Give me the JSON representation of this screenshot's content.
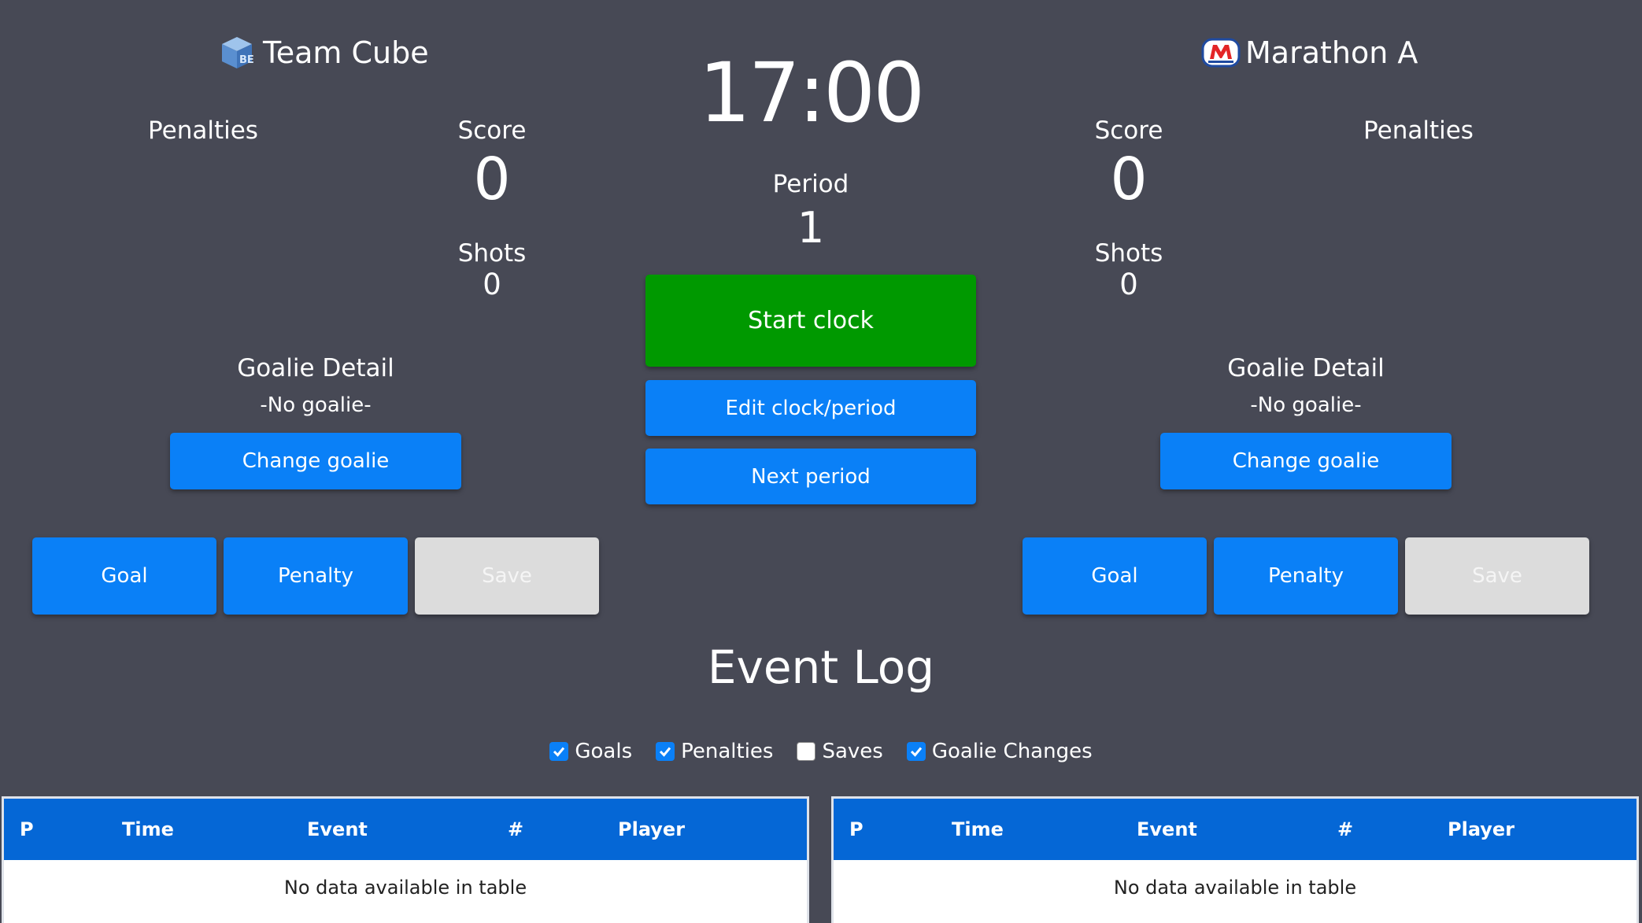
{
  "teams": {
    "home": {
      "name": "Team Cube",
      "logo_icon": "cube-logo-icon",
      "penalties_label": "Penalties",
      "score_label": "Score",
      "score": "0",
      "shots_label": "Shots",
      "shots": "0",
      "goalie_title": "Goalie Detail",
      "goalie": "-No goalie-",
      "change_goalie_label": "Change goalie",
      "goal_label": "Goal",
      "penalty_label": "Penalty",
      "save_label": "Save"
    },
    "away": {
      "name": "Marathon A",
      "logo_icon": "marathon-logo-icon",
      "penalties_label": "Penalties",
      "score_label": "Score",
      "score": "0",
      "shots_label": "Shots",
      "shots": "0",
      "goalie_title": "Goalie Detail",
      "goalie": "-No goalie-",
      "change_goalie_label": "Change goalie",
      "goal_label": "Goal",
      "penalty_label": "Penalty",
      "save_label": "Save"
    }
  },
  "clock": {
    "time": "17:00",
    "period_label": "Period",
    "period": "1",
    "start_label": "Start clock",
    "edit_label": "Edit clock/period",
    "next_label": "Next period"
  },
  "event_log": {
    "title": "Event Log",
    "filters": [
      {
        "label": "Goals",
        "checked": true
      },
      {
        "label": "Penalties",
        "checked": true
      },
      {
        "label": "Saves",
        "checked": false
      },
      {
        "label": "Goalie Changes",
        "checked": true
      }
    ],
    "columns": [
      "P",
      "Time",
      "Event",
      "#",
      "Player"
    ],
    "empty_message": "No data available in table"
  },
  "colors": {
    "background": "#474955",
    "primary_button": "#0a80f7",
    "start_button": "#009900",
    "disabled_button": "#dcdcdc",
    "table_header": "#0567d6"
  }
}
